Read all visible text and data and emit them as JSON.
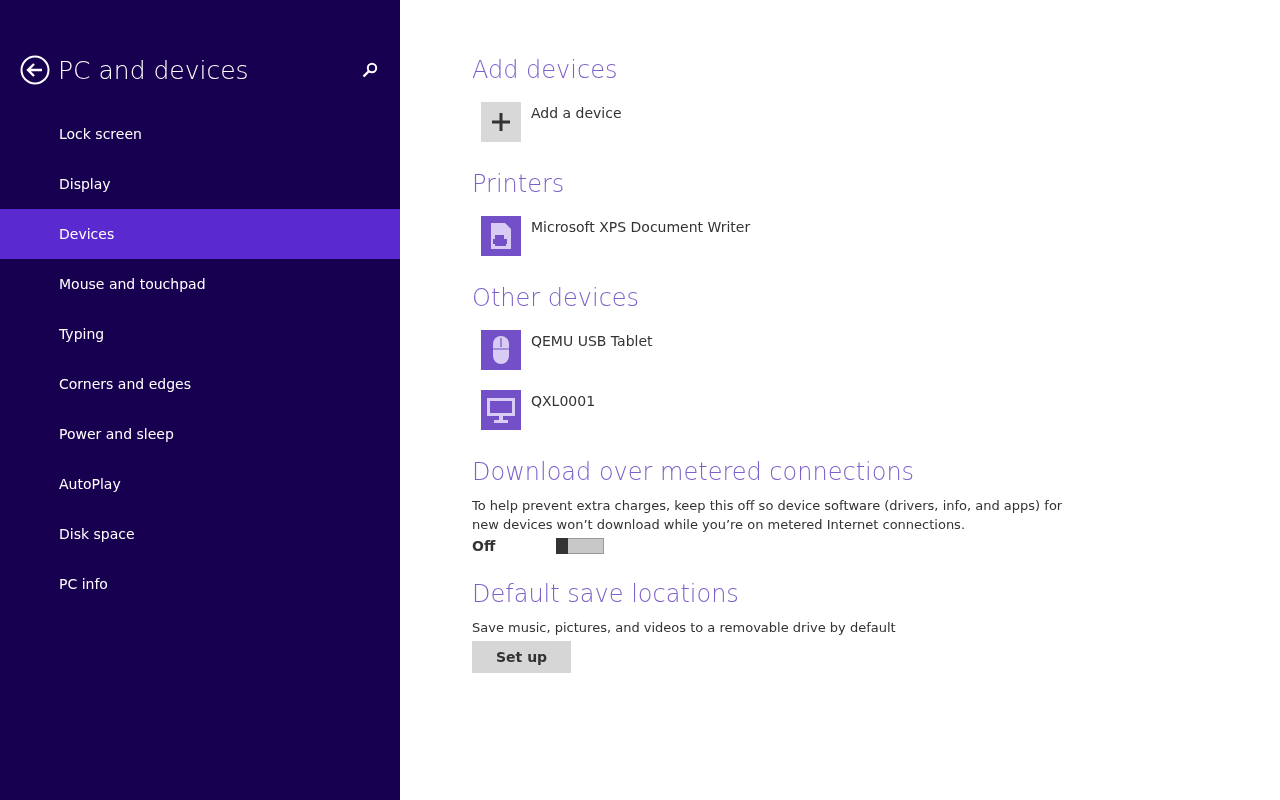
{
  "sidebar": {
    "title": "PC and devices",
    "items": [
      {
        "label": "Lock screen",
        "selected": false
      },
      {
        "label": "Display",
        "selected": false
      },
      {
        "label": "Devices",
        "selected": true
      },
      {
        "label": "Mouse and touchpad",
        "selected": false
      },
      {
        "label": "Typing",
        "selected": false
      },
      {
        "label": "Corners and edges",
        "selected": false
      },
      {
        "label": "Power and sleep",
        "selected": false
      },
      {
        "label": "AutoPlay",
        "selected": false
      },
      {
        "label": "Disk space",
        "selected": false
      },
      {
        "label": "PC info",
        "selected": false
      }
    ]
  },
  "sections": [
    {
      "kind": "devices",
      "heading": "Add devices",
      "devices": [
        {
          "kind": "add",
          "name": "Add a device"
        }
      ]
    },
    {
      "kind": "devices",
      "heading": "Printers",
      "devices": [
        {
          "kind": "printer",
          "name": "Microsoft XPS Document Writer"
        }
      ]
    },
    {
      "kind": "devices",
      "heading": "Other devices",
      "devices": [
        {
          "kind": "mouse",
          "name": "QEMU USB Tablet"
        },
        {
          "kind": "monitor",
          "name": "QXL0001"
        }
      ]
    },
    {
      "kind": "toggle",
      "heading": "Download over metered connections",
      "description": "To help prevent extra charges, keep this off so device software (drivers, info, and apps) for new devices won’t download while you’re on metered Internet connections.",
      "state_label": "Off",
      "on": false
    },
    {
      "kind": "button",
      "heading": "Default save locations",
      "description": "Save music, pictures, and videos to a removable drive by default",
      "button": "Set up"
    }
  ]
}
